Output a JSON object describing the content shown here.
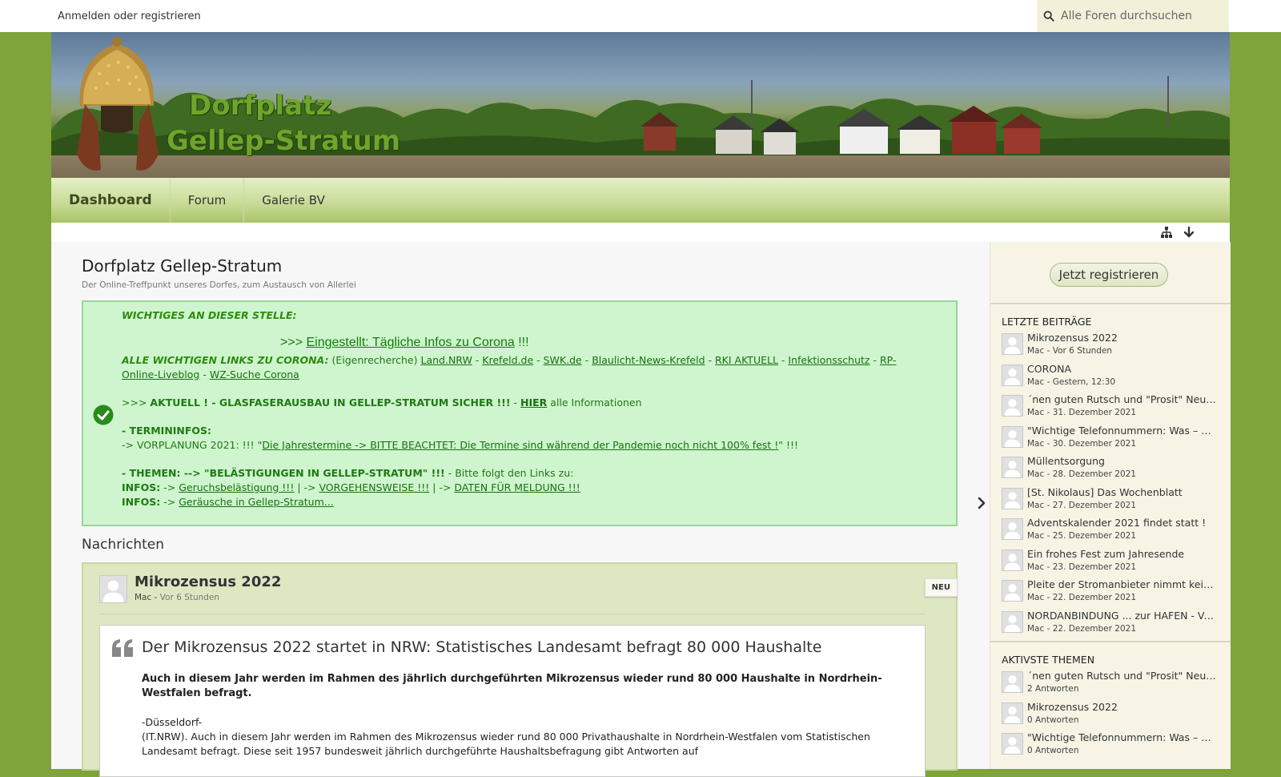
{
  "topbar": {
    "login_text": "Anmelden oder registrieren",
    "search_placeholder": "Alle Foren durchsuchen"
  },
  "header": {
    "title_line1": "Dorfplatz",
    "title_line2": "Gellep-Stratum"
  },
  "nav": {
    "items": [
      {
        "label": "Dashboard",
        "active": true
      },
      {
        "label": "Forum",
        "active": false
      },
      {
        "label": "Galerie BV",
        "active": false
      }
    ]
  },
  "page": {
    "title": "Dorfplatz Gellep-Stratum",
    "subtitle": "Der Online-Treffpunkt unseres Dorfes, zum Austausch von Allerlei"
  },
  "notice": {
    "heading": "WICHTIGES AN DIESER STELLE:",
    "corona_prefix": ">>> ",
    "corona_link": "Eingestellt: Tägliche Infos zu Corona",
    "corona_suffix": " !!!",
    "links_label": "ALLE WICHTIGEN LINKS ZU CORONA:",
    "links_note": " (Eigenrecherche) ",
    "links": [
      "Land.NRW",
      "Krefeld.de",
      "SWK.de",
      "Blaulicht-News-Krefeld",
      "RKI AKTUELL",
      "Infektionsschutz",
      "RP-Online-Liveblog",
      "WZ-Suche Corona"
    ],
    "glas_prefix": ">>> ",
    "glas_text": "AKTUELL ! - GLASFASERAUSBAU IN GELLEP-STRATUM SICHER !!!",
    "glas_dash": " - ",
    "glas_link": "HIER",
    "glas_suffix": " alle Informationen",
    "termin_heading": "- TERMININFOS:",
    "termin_prefix": "-> VORPLANUNG 2021: !!! \"",
    "termin_link": "Die Jahrestermine -> BITTE BEACHTET: Die Termine sind während der Pandemie noch nicht 100% fest !",
    "termin_suffix": "\" !!!",
    "themen_bold": "- THEMEN: --> \"BELÄSTIGUNGEN IN GELLEP-STRATUM\" !!!",
    "themen_rest": " - Bitte folgt den Links zu:",
    "infos_label": "INFOS:",
    "arrow": " -> ",
    "infos_link1": "Geruchsbelästigung !!!",
    "infos_link2": "VORGEHENSWEISE !!!",
    "infos_link3": "DATEN FÜR MELDUNG !!!",
    "infos_link4": "Geräusche in Gellep-Stratum...",
    "pipe": " | -> "
  },
  "news": {
    "heading": "Nachrichten",
    "title": "Mikrozensus 2022",
    "author": "Mac",
    "time": "Vor 6 Stunden",
    "badge": "NEU",
    "quote_heading": "Der Mikrozensus 2022 startet in NRW: Statistisches Landesamt befragt 80 000 Haushalte",
    "lead": "Auch in diesem Jahr werden im Rahmen des jährlich durchgeführten Mikrozensus wieder rund 80 000 Haushalte in Nordrhein-Westfalen befragt.",
    "place": "-Düsseldorf-",
    "para": "(IT.NRW). Auch in diesem Jahr werden im Rahmen des Mikrozensus wieder rund 80 000 Privathaushalte in Nordrhein-Westfalen vom Statistischen Landesamt befragt. Diese seit 1957 bundesweit jährlich durchgeführte Haushaltsbefragung gibt Antworten auf"
  },
  "sidebar": {
    "register_label": "Jetzt registrieren",
    "recent_heading": "LETZTE BEITRÄGE",
    "recent": [
      {
        "title": "Mikrozensus 2022",
        "meta": "Mac - Vor 6 Stunden"
      },
      {
        "title": "CORONA",
        "meta": "Mac - Gestern, 12:30"
      },
      {
        "title": "´nen guten Rutsch und \"Prosit\" Neu J...",
        "meta": "Mac - 31. Dezember 2021"
      },
      {
        "title": "\"Wichtige Telefonnummern: Was – W...",
        "meta": "Mac - 30. Dezember 2021"
      },
      {
        "title": "Müllentsorgung",
        "meta": "Mac - 28. Dezember 2021"
      },
      {
        "title": "[St. Nikolaus] Das Wochenblatt",
        "meta": "Mac - 27. Dezember 2021"
      },
      {
        "title": "Adventskalender 2021 findet statt !",
        "meta": "Mac - 25. Dezember 2021"
      },
      {
        "title": "Ein frohes Fest zum Jahresende",
        "meta": "Mac - 23. Dezember 2021"
      },
      {
        "title": "Pleite der Stromanbieter nimmt kein ...",
        "meta": "Mac - 22. Dezember 2021"
      },
      {
        "title": "NORDANBINDUNG ... zur HAFEN - Ve...",
        "meta": "Mac - 22. Dezember 2021"
      }
    ],
    "active_heading": "AKTIVSTE THEMEN",
    "active": [
      {
        "title": "´nen guten Rutsch und \"Prosit\" Neu J...",
        "meta": "2 Antworten"
      },
      {
        "title": "Mikrozensus 2022",
        "meta": "0 Antworten"
      },
      {
        "title": "\"Wichtige Telefonnummern: Was – W...",
        "meta": "0 Antworten"
      }
    ]
  },
  "icons": {
    "search": "search-icon",
    "sitemap": "sitemap-icon",
    "scroll_down": "arrow-down-icon",
    "check": "check-circle-icon",
    "quote": "quote-icon",
    "sidebar_toggle": "chevron-right-icon"
  },
  "colors": {
    "background": "#7fa43a",
    "notice_bg": "#cff5cf",
    "notice_text": "#1e7a12",
    "nav_gradient_top": "#e4efc7",
    "nav_gradient_bottom": "#aac46a"
  }
}
